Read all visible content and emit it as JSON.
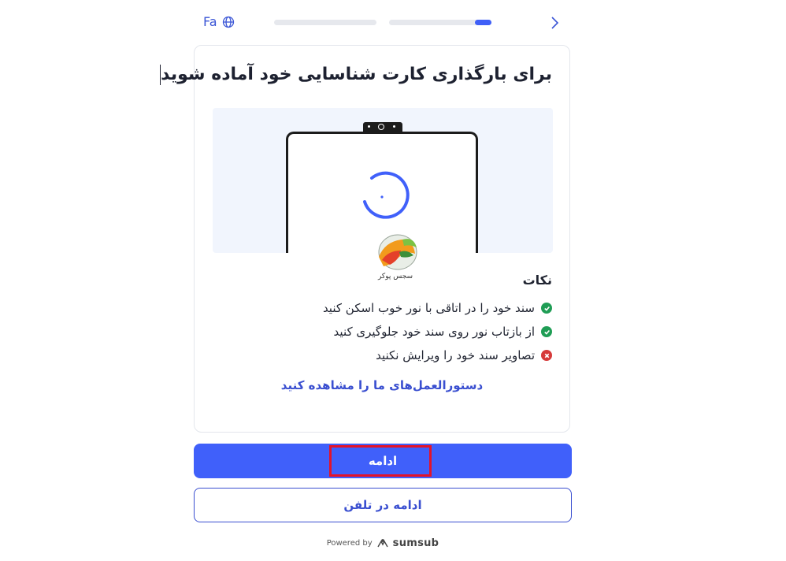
{
  "header": {
    "language": "Fa",
    "progress_segments": [
      {
        "fill_fraction": 0
      },
      {
        "fill_fraction": 0.16
      }
    ]
  },
  "card": {
    "title": "برای بارگذاری کارت شناسایی خود آماده شوید",
    "watermark_text": "سجس پوکر",
    "tips_title": "نکات",
    "tips": [
      {
        "text": "سند خود را در اتاقی با نور خوب اسکن کنید",
        "status": "ok",
        "icon": "check-icon"
      },
      {
        "text": "از بازتاب نور روی سند خود جلوگیری کنید",
        "status": "ok",
        "icon": "check-icon"
      },
      {
        "text": "تصاویر سند خود را ویرایش نکنید",
        "status": "bad",
        "icon": "cross-icon"
      }
    ],
    "guide_link": "دستورالعمل‌های ما را مشاهده کنید"
  },
  "actions": {
    "continue_label": "ادامه",
    "continue_on_phone_label": "ادامه در تلفن"
  },
  "footer": {
    "powered_by": "Powered by",
    "brand": "sumsub"
  },
  "colors": {
    "accent": "#4060fa",
    "link": "#3a4fd0",
    "ok": "#1f9d55",
    "bad": "#d63a3a",
    "highlight": "#e3132a"
  }
}
